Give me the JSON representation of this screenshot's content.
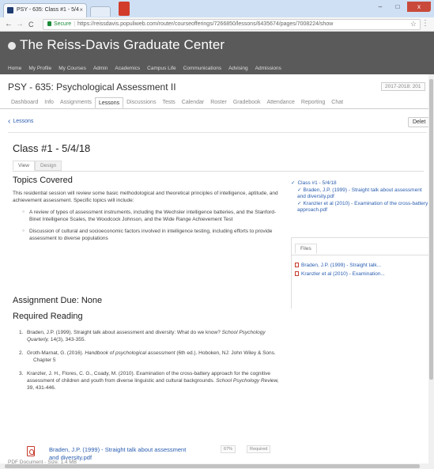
{
  "browser": {
    "tab_title": "PSY - 635: Class #1 - 5/4",
    "close_glyph": "×",
    "back_glyph": "←",
    "forward_glyph": "→",
    "reload_glyph": "C",
    "secure_label": "Secure",
    "url": "https://reissdavis.populiweb.com/router/courseofferings/7266850/lessons/6435674/pages/7008224/show",
    "star_glyph": "☆",
    "menu_glyph": "⋮",
    "minimize_glyph": "–",
    "maximize_glyph": "□",
    "window_close_glyph": "x"
  },
  "site": {
    "title": "The Reiss-Davis Graduate Center",
    "nav": [
      "Home",
      "My Profile",
      "My Courses",
      "Admin",
      "Academics",
      "Campus Life",
      "Communications",
      "Advising",
      "Admissions"
    ]
  },
  "course": {
    "title": "PSY - 635: Psychological Assessment II",
    "term": "2017-2018: 201",
    "tabs": [
      "Dashboard",
      "Info",
      "Assignments",
      "Lessons",
      "Discussions",
      "Tests",
      "Calendar",
      "Roster",
      "Gradebook",
      "Attendance",
      "Reporting",
      "Chat"
    ],
    "active_tab": "Lessons"
  },
  "lesson": {
    "back_label": "Lessons",
    "delete_label": "Delet",
    "title": "Class #1 - 5/4/18",
    "view_tabs": [
      "View",
      "Design"
    ],
    "topics_heading": "Topics Covered",
    "intro": "This residential session will review some basic methodological and theoretical principles of intelligence, aptitude, and achievement assessment.  Specific topics will include:",
    "topics": [
      "A review of types of assessment instruments, including the Wechsler intelligence batteries, and the Stanford-Binet Intelligence Scales, the Woodcock Johnson, and the Wide Range Achievement Test",
      "Discussion of cultural and socioeconomic factors involved in intelligence testing, including efforts to provide assessment to diverse populations"
    ],
    "assignment_heading": "Assignment Due: None",
    "reading_heading": "Required Reading",
    "readings": [
      {
        "num": "1.",
        "before": "Braden, J.P. (1999). Straight talk about assessment and diversity: What do we know? ",
        "italic": "School Psychology Quarterly,",
        "after": " 14(3), 343-355."
      },
      {
        "num": "2.",
        "before": "Groth-Marnat, G. (2016). ",
        "italic": "Handbook of psychological assessment",
        "after": " (6th ed.). Hoboken, NJ: John Wiley & Sons.",
        "extra": "Chapter 5"
      },
      {
        "num": "3.",
        "before": "Kranzler, J. H., Flores, C. G., Coady, M. (2010). Examination of the cross-battery approach for the cognitive assessment of children and youth from diverse linguistic and cultural backgrounds. ",
        "italic": "School Psychology Review,",
        "after": " 39, 431-446."
      }
    ],
    "file": {
      "name": "Braden, J.P. (1999) - Straight talk about assessment and diversity.pdf",
      "percent": "67%",
      "required": "Required",
      "meta": "PDF Document - Size: 1.4 MB"
    }
  },
  "sidebar": {
    "check_glyph": "✓",
    "heading": "Class #1 - 5/4/18",
    "items": [
      "Braden, J.P. (1999) - Straight talk about assessment and diversity.pdf",
      "Kranzler et al (2010) - Examination of the cross-battery approach.pdf"
    ],
    "files_tab": "Files",
    "files": [
      "Braden, J.P. (1999) - Straight talk...",
      "Kranzler et al (2010) - Examination..."
    ]
  },
  "colors": {
    "link": "#2a5db0",
    "header_bg": "#5a5a5a",
    "pdf_red": "#c63a2c"
  }
}
